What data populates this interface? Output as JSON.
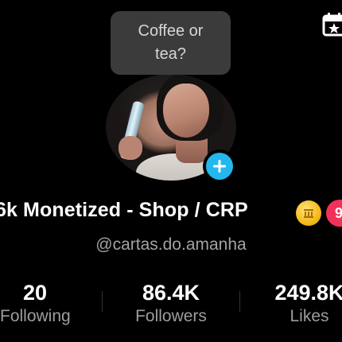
{
  "tooltip": {
    "text": "Coffee or\ntea?"
  },
  "profile": {
    "display_name": "6k Monetized - Shop / CRP",
    "badge_count": "9",
    "username": "@cartas.do.amanha"
  },
  "stats": [
    {
      "value": "20",
      "label": "Following"
    },
    {
      "value": "86.4K",
      "label": "Followers"
    },
    {
      "value": "249.8K",
      "label": "Likes"
    }
  ],
  "icons": {
    "corner": "calendar-star-icon",
    "add": "plus-icon",
    "coin": "coin-icon"
  },
  "colors": {
    "accent_blue": "#24b7ee",
    "badge_red": "#f2315a",
    "coin_gold": "#f5b91a"
  }
}
